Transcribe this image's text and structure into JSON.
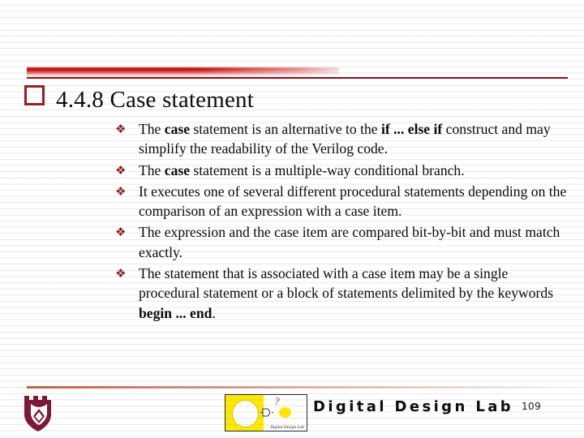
{
  "slide": {
    "title_bullet_icon": "hollow-square-bullet",
    "title": "4.4.8 Case statement",
    "bullets": [
      {
        "marker": "❖",
        "runs": [
          {
            "text": "The ",
            "bold": false
          },
          {
            "text": "case",
            "bold": true
          },
          {
            "text": " statement is an alternative to the ",
            "bold": false
          },
          {
            "text": "if ... else if",
            "bold": true
          },
          {
            "text": " construct and may simplify the readability of the Verilog code.",
            "bold": false
          }
        ]
      },
      {
        "marker": "❖",
        "runs": [
          {
            "text": "The ",
            "bold": false
          },
          {
            "text": "case",
            "bold": true
          },
          {
            "text": " statement is a multiple-way conditional branch.",
            "bold": false
          }
        ]
      },
      {
        "marker": "❖",
        "runs": [
          {
            "text": "It executes one of several different procedural statements depending on the comparison of an expression with a case item.",
            "bold": false
          }
        ]
      },
      {
        "marker": "❖",
        "runs": [
          {
            "text": "The expression and the case item are compared bit-by-bit and must match exactly.",
            "bold": false
          }
        ]
      },
      {
        "marker": "❖",
        "runs": [
          {
            "text": "The statement that is associated with a case item may be a single procedural statement or a block of statements delimited by the keywords ",
            "bold": false
          },
          {
            "text": "begin ... end",
            "bold": true
          },
          {
            "text": ".",
            "bold": false
          }
        ]
      }
    ]
  },
  "footer": {
    "shield_icon": "university-shield-crest-icon",
    "logo_icon": "digital-design-lab-logo-icon",
    "logo_question_mark": "?",
    "logo_caption": "Digital Design Lab",
    "lab_title": "Digital Design Lab",
    "page_number": "109"
  },
  "colors": {
    "accent_red": "#c81010",
    "bullet_red": "#8e1c1c",
    "title_bullet_red": "#9b1b20",
    "shield_maroon": "#7d1733",
    "logo_yellow": "#ffe800",
    "rule_dark": "#7a1c22",
    "text_black": "#080808",
    "background": "#ffffff"
  }
}
